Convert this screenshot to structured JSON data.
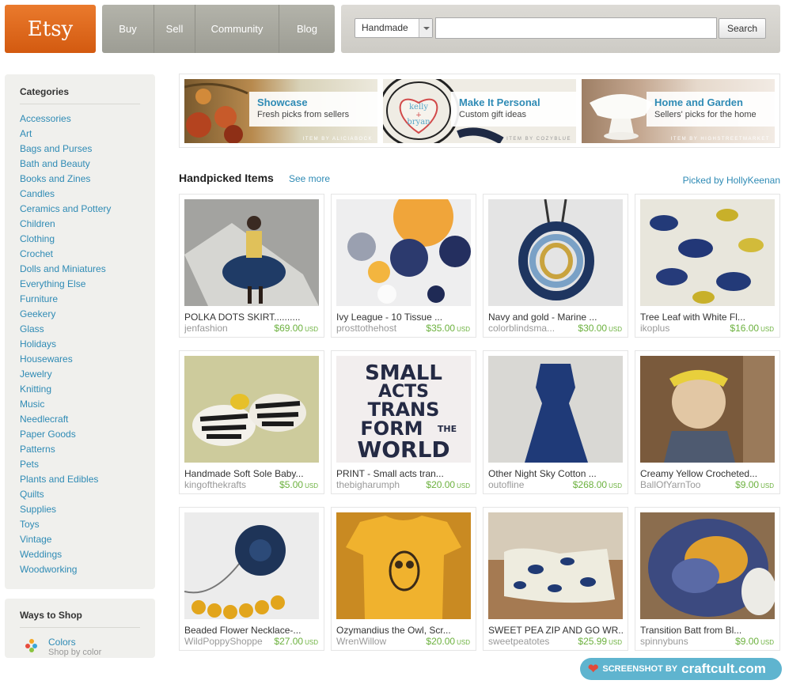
{
  "header": {
    "logo": "Etsy",
    "nav": [
      "Buy",
      "Sell",
      "Community",
      "Blog"
    ],
    "search": {
      "category": "Handmade",
      "value": "",
      "button": "Search"
    }
  },
  "sidebar": {
    "categories_title": "Categories",
    "categories": [
      "Accessories",
      "Art",
      "Bags and Purses",
      "Bath and Beauty",
      "Books and Zines",
      "Candles",
      "Ceramics and Pottery",
      "Children",
      "Clothing",
      "Crochet",
      "Dolls and Miniatures",
      "Everything Else",
      "Furniture",
      "Geekery",
      "Glass",
      "Holidays",
      "Housewares",
      "Jewelry",
      "Knitting",
      "Music",
      "Needlecraft",
      "Paper Goods",
      "Patterns",
      "Pets",
      "Plants and Edibles",
      "Quilts",
      "Supplies",
      "Toys",
      "Vintage",
      "Weddings",
      "Woodworking"
    ],
    "ways_title": "Ways to Shop",
    "ways_link": "Colors",
    "ways_sub": "Shop by color"
  },
  "banner": [
    {
      "title": "Showcase",
      "subtitle": "Fresh picks from sellers",
      "credit": "ITEM BY ALICIABOCK"
    },
    {
      "title": "Make It Personal",
      "subtitle": "Custom gift ideas",
      "credit": "ITEM BY COZYBLUE"
    },
    {
      "title": "Home and Garden",
      "subtitle": "Sellers' picks for the home",
      "credit": "ITEM BY HIGHSTREETMARKET"
    }
  ],
  "banner_art": {
    "kelly": "kelly",
    "plus": "+",
    "bryan": "bryan"
  },
  "handpicked": {
    "title": "Handpicked Items",
    "see_more": "See more",
    "picked_by": "Picked by HollyKeenan",
    "items": [
      {
        "title": "POLKA DOTS SKIRT..........",
        "shop": "jenfashion",
        "price": "$69.00",
        "currency": "USD"
      },
      {
        "title": "Ivy League - 10 Tissue ...",
        "shop": "prosttothehost",
        "price": "$35.00",
        "currency": "USD"
      },
      {
        "title": "Navy and gold - Marine ...",
        "shop": "colorblindsma...",
        "price": "$30.00",
        "currency": "USD"
      },
      {
        "title": "Tree Leaf with White Fl...",
        "shop": "ikoplus",
        "price": "$16.00",
        "currency": "USD"
      },
      {
        "title": "Handmade Soft Sole Baby...",
        "shop": "kingofthekrafts",
        "price": "$5.00",
        "currency": "USD"
      },
      {
        "title": "PRINT - Small acts tran...",
        "shop": "thebigharumph",
        "price": "$20.00",
        "currency": "USD"
      },
      {
        "title": "Other Night Sky Cotton ...",
        "shop": "outofline",
        "price": "$268.00",
        "currency": "USD"
      },
      {
        "title": "Creamy Yellow Crocheted...",
        "shop": "BallOfYarnToo",
        "price": "$9.00",
        "currency": "USD"
      },
      {
        "title": "Beaded Flower Necklace-...",
        "shop": "WildPoppyShoppe",
        "price": "$27.00",
        "currency": "USD"
      },
      {
        "title": "Ozymandius the Owl, Scr...",
        "shop": "WrenWillow",
        "price": "$20.00",
        "currency": "USD"
      },
      {
        "title": "SWEET PEA ZIP AND GO WR...",
        "shop": "sweetpeatotes",
        "price": "$25.99",
        "currency": "USD"
      },
      {
        "title": "Transition Batt from Bl...",
        "shop": "spinnybuns",
        "price": "$9.00",
        "currency": "USD"
      }
    ]
  },
  "print_art": [
    "SMALL",
    "ACTS",
    "TRANS",
    "FORM",
    "THE",
    "WORLD"
  ],
  "watermark": {
    "prefix": "SCREENSHOT BY",
    "brand": "craftcult.com"
  }
}
